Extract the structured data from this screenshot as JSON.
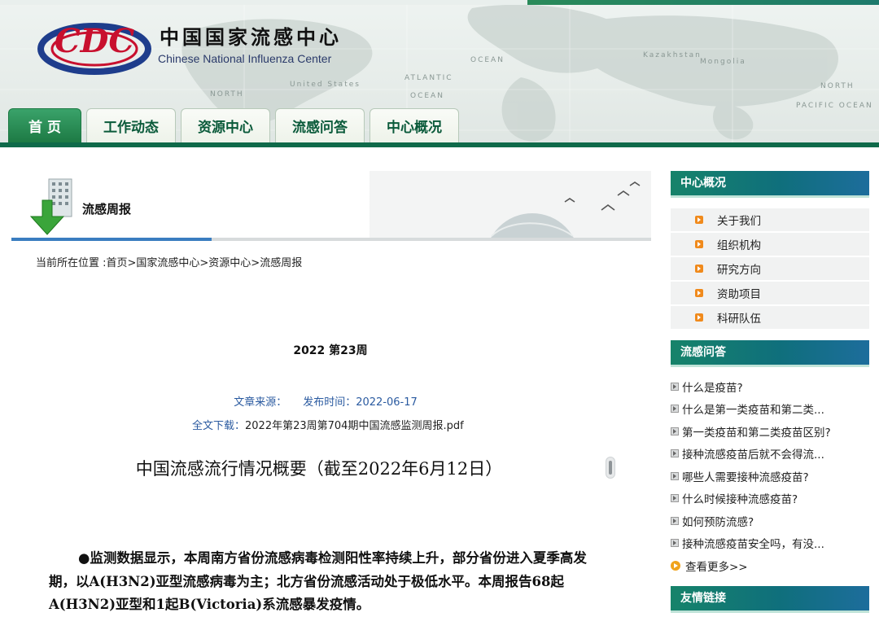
{
  "header": {
    "site_title_cn": "中国国家流感中心",
    "site_title_en": "Chinese National Influenza Center",
    "logo_text": "CDC",
    "map_labels": [
      "ATLANTIC",
      "OCEAN",
      "NORTH",
      "United States",
      "OCEAN",
      "Kazakhstan",
      "Mongolia",
      "NORTH",
      "PACIFIC OCEAN"
    ]
  },
  "nav": {
    "tabs": [
      {
        "label": "首 页",
        "active": true
      },
      {
        "label": "工作动态",
        "active": false
      },
      {
        "label": "资源中心",
        "active": false
      },
      {
        "label": "流感问答",
        "active": false
      },
      {
        "label": "中心概况",
        "active": false
      }
    ]
  },
  "banner": {
    "title": "流感周报"
  },
  "breadcrumb": "当前所在位置 :首页>国家流感中心>资源中心>流感周报",
  "article": {
    "week": "2022 第23周",
    "source_label": "文章来源：",
    "date_label": "发布时间：",
    "date": "2022-06-17",
    "download_label": "全文下载：",
    "download_file": "2022年第23周第704期中国流感监测周报.pdf",
    "heading": "中国流感流行情况概要（截至2022年6月12日）",
    "body": "●监测数据显示，本周南方省份流感病毒检测阳性率持续上升，部分省份进入夏季高发期，以A(H3N2)亚型流感病毒为主；北方省份流感活动处于极低水平。本周报告68起A(H3N2)亚型和1起B(Victoria)系流感暴发疫情。"
  },
  "sidebar": {
    "about": {
      "title": "中心概况",
      "items": [
        "关于我们",
        "组织机构",
        "研究方向",
        "资助项目",
        "科研队伍"
      ]
    },
    "faq": {
      "title": "流感问答",
      "items": [
        "什么是疫苗?",
        "什么是第一类疫苗和第二类...",
        "第一类疫苗和第二类疫苗区别?",
        "接种流感疫苗后就不会得流...",
        "哪些人需要接种流感疫苗?",
        "什么时候接种流感疫苗?",
        "如何预防流感?",
        "接种流感疫苗安全吗，有没..."
      ],
      "more": "查看更多>>"
    },
    "links": {
      "title": "友情链接"
    }
  },
  "colors": {
    "nav_active": "#1d7a44",
    "nav_text": "#0a5a3a",
    "sidebar_head": "#0f6f7c",
    "link_blue": "#2a5aa0",
    "bullet_orange": "#f08a1c"
  }
}
